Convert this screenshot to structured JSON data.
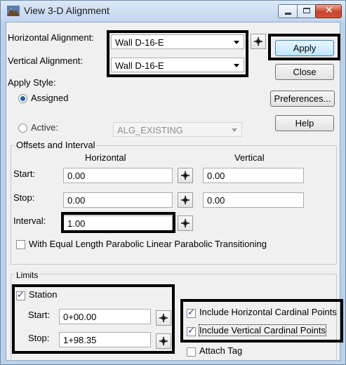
{
  "window": {
    "title": "View 3-D Alignment"
  },
  "alignment": {
    "horizontal_label": "Horizontal Alignment:",
    "horizontal_value": "Wall D-16-E",
    "vertical_label": "Vertical Alignment:",
    "vertical_value": "Wall D-16-E"
  },
  "buttons": {
    "apply": "Apply",
    "close": "Close",
    "preferences": "Preferences...",
    "help": "Help"
  },
  "apply_style": {
    "label": "Apply Style:",
    "assigned": "Assigned",
    "active": "Active:",
    "active_value": "ALG_EXISTING"
  },
  "offsets": {
    "group_label": "Offsets and Interval",
    "horizontal_header": "Horizontal",
    "vertical_header": "Vertical",
    "start_label": "Start:",
    "stop_label": "Stop:",
    "interval_label": "Interval:",
    "start_h": "0.00",
    "start_v": "0.00",
    "stop_h": "0.00",
    "stop_v": "0.00",
    "interval": "1.00",
    "equal_length": "With Equal Length Parabolic Linear Parabolic Transitioning"
  },
  "limits": {
    "group_label": "Limits",
    "station": "Station",
    "start_label": "Start:",
    "start_value": "0+00.00",
    "stop_label": "Stop:",
    "stop_value": "1+98.35",
    "include_horizontal": "Include Horizontal Cardinal Points",
    "include_vertical": "Include Vertical Cardinal Points",
    "attach_tag": "Attach Tag"
  }
}
